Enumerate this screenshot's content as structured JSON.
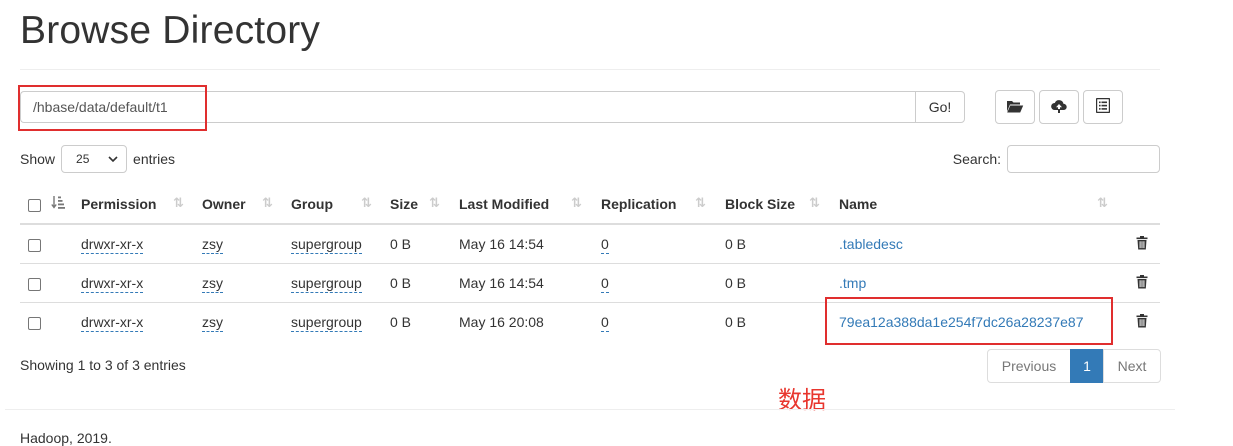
{
  "page": {
    "title": "Browse Directory"
  },
  "path_bar": {
    "value": "/hbase/data/default/t1",
    "go_label": "Go!"
  },
  "toolbar": {
    "icons": [
      "folder-open-icon",
      "cloud-upload-icon",
      "list-alt-icon"
    ]
  },
  "controls": {
    "show_label": "Show",
    "page_length": "25",
    "entries_label": "entries",
    "search_label": "Search:"
  },
  "table": {
    "columns": [
      "Permission",
      "Owner",
      "Group",
      "Size",
      "Last Modified",
      "Replication",
      "Block Size",
      "Name"
    ],
    "rows": [
      {
        "permission": "drwxr-xr-x",
        "owner": "zsy",
        "group": "supergroup",
        "size": "0 B",
        "last_modified": "May 16 14:54",
        "replication": "0",
        "block_size": "0 B",
        "name": ".tabledesc"
      },
      {
        "permission": "drwxr-xr-x",
        "owner": "zsy",
        "group": "supergroup",
        "size": "0 B",
        "last_modified": "May 16 14:54",
        "replication": "0",
        "block_size": "0 B",
        "name": ".tmp"
      },
      {
        "permission": "drwxr-xr-x",
        "owner": "zsy",
        "group": "supergroup",
        "size": "0 B",
        "last_modified": "May 16 20:08",
        "replication": "0",
        "block_size": "0 B",
        "name": "79ea12a388da1e254f7dc26a28237e87"
      }
    ]
  },
  "info": "Showing 1 to 3 of 3 entries",
  "pagination": {
    "previous": "Previous",
    "current": "1",
    "next": "Next"
  },
  "annotation": "数据",
  "footer": "Hadoop, 2019.",
  "colors": {
    "highlight_box": "#e02e2e",
    "link": "#337ab7",
    "active_page": "#337ab7",
    "annotation": "#e8362e"
  }
}
